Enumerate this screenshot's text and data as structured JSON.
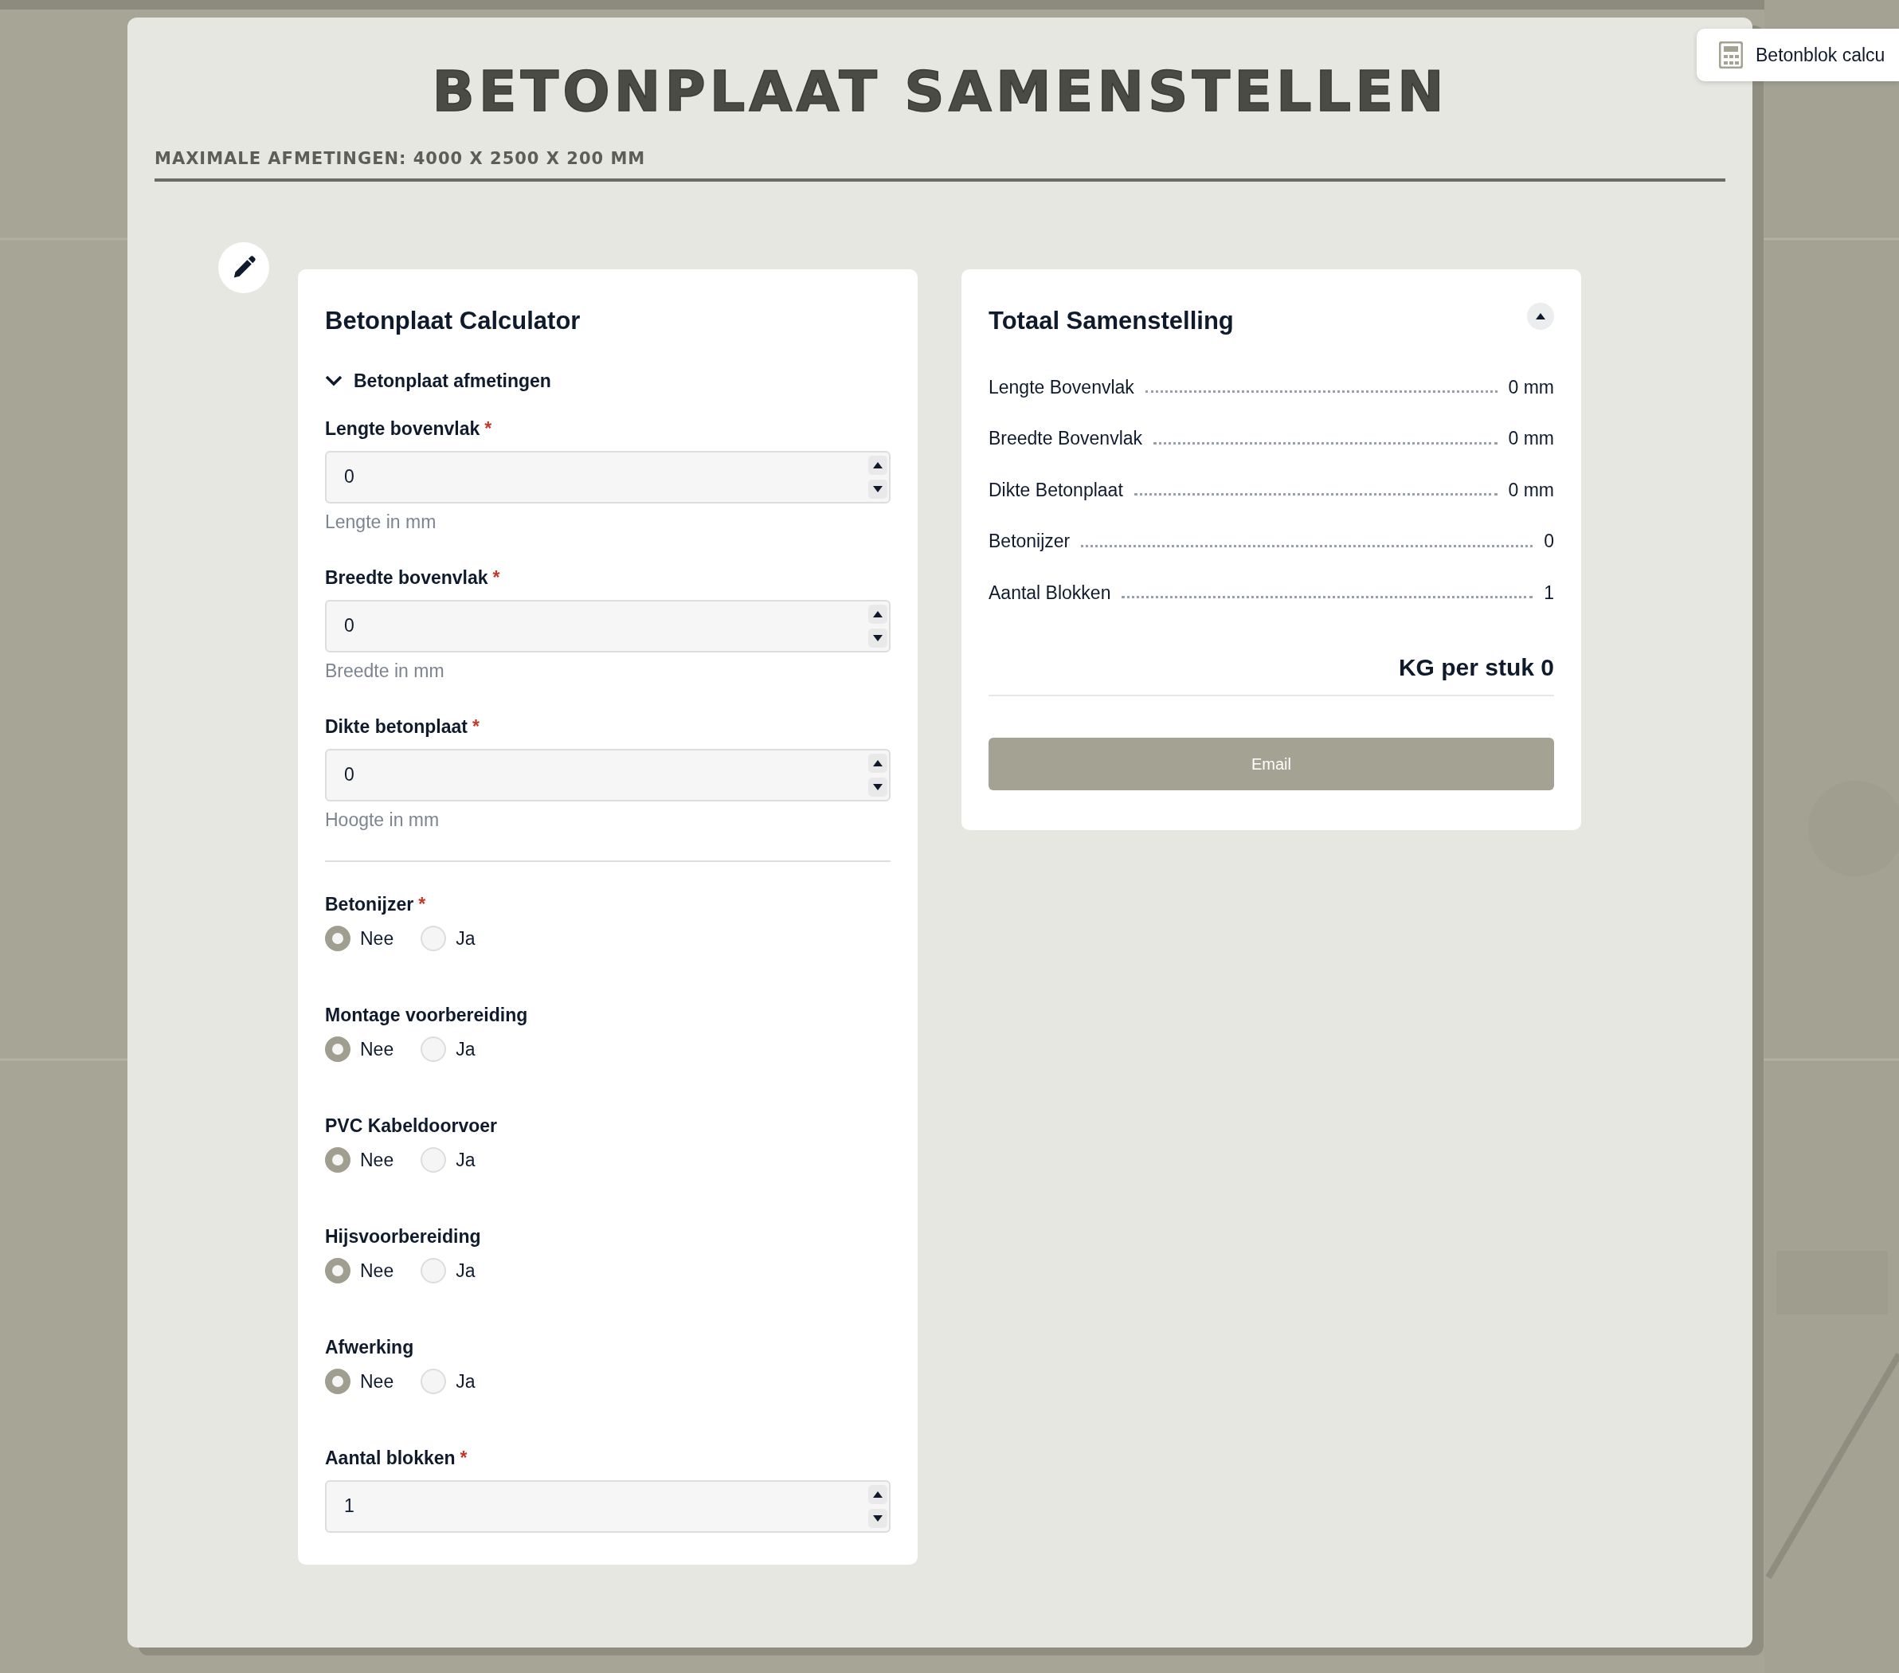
{
  "page": {
    "title": "BETONPLAAT SAMENSTELLEN",
    "subtitle": "MAXIMALE AFMETINGEN: 4000 X 2500 X 200 MM"
  },
  "side_button": {
    "label": "Betonblok calcu"
  },
  "calculator": {
    "title": "Betonplaat Calculator",
    "section": {
      "label": "Betonplaat afmetingen",
      "expanded": true
    },
    "fields": [
      {
        "label": "Lengte bovenvlak",
        "required_mark": "*",
        "value": "0",
        "help": "Lengte in mm"
      },
      {
        "label": "Breedte bovenvlak",
        "required_mark": "*",
        "value": "0",
        "help": "Breedte in mm"
      },
      {
        "label": "Dikte betonplaat",
        "required_mark": "*",
        "value": "0",
        "help": "Hoogte in mm"
      }
    ],
    "options": [
      {
        "label": "Betonijzer",
        "required_mark": "*",
        "choices": [
          {
            "label": "Nee",
            "selected": true
          },
          {
            "label": "Ja",
            "selected": false
          }
        ]
      },
      {
        "label": "Montage voorbereiding",
        "choices": [
          {
            "label": "Nee",
            "selected": true
          },
          {
            "label": "Ja",
            "selected": false
          }
        ]
      },
      {
        "label": "PVC Kabeldoorvoer",
        "choices": [
          {
            "label": "Nee",
            "selected": true
          },
          {
            "label": "Ja",
            "selected": false
          }
        ]
      },
      {
        "label": "Hijsvoorbereiding",
        "choices": [
          {
            "label": "Nee",
            "selected": true
          },
          {
            "label": "Ja",
            "selected": false
          }
        ]
      },
      {
        "label": "Afwerking",
        "choices": [
          {
            "label": "Nee",
            "selected": true
          },
          {
            "label": "Ja",
            "selected": false
          }
        ]
      }
    ],
    "count_field": {
      "label": "Aantal blokken",
      "required_mark": "*",
      "value": "1"
    }
  },
  "summary": {
    "title": "Totaal Samenstelling",
    "expanded": true,
    "rows": [
      {
        "label": "Lengte Bovenvlak",
        "value": "0 mm"
      },
      {
        "label": "Breedte Bovenvlak",
        "value": "0 mm"
      },
      {
        "label": "Dikte Betonplaat",
        "value": "0 mm"
      },
      {
        "label": "Betonijzer",
        "value": "0"
      },
      {
        "label": "Aantal Blokken",
        "value": "1"
      }
    ],
    "total": "KG per stuk 0",
    "button": "Email"
  }
}
